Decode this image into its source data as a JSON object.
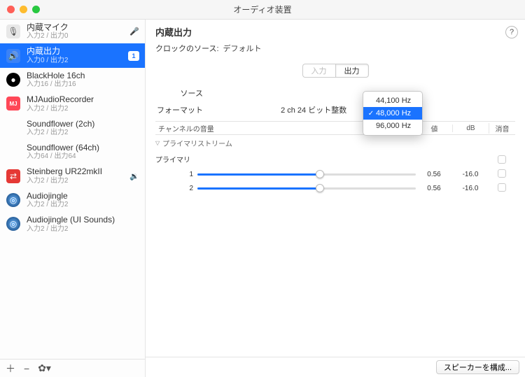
{
  "window": {
    "title": "オーディオ装置"
  },
  "sidebar": {
    "devices": [
      {
        "name": "内蔵マイク",
        "sub": "入力2 / 出力0",
        "icon": "mic",
        "indicator": "mic"
      },
      {
        "name": "内蔵出力",
        "sub": "入力0 / 出力2",
        "icon": "speaker",
        "selected": true,
        "badge": "1"
      },
      {
        "name": "BlackHole 16ch",
        "sub": "入力16 / 出力16",
        "icon": "blackhole"
      },
      {
        "name": "MJAudioRecorder",
        "sub": "入力2 / 出力2",
        "icon": "mj"
      },
      {
        "name": "Soundflower (2ch)",
        "sub": "入力2 / 出力2",
        "icon": "generic"
      },
      {
        "name": "Soundflower (64ch)",
        "sub": "入力64 / 出力64",
        "icon": "generic"
      },
      {
        "name": "Steinberg UR22mkII",
        "sub": "入力2 / 出力2",
        "icon": "steinberg",
        "indicator": "vol"
      },
      {
        "name": "Audiojingle",
        "sub": "入力2 / 出力2",
        "icon": "audiojingle"
      },
      {
        "name": "Audiojingle (UI Sounds)",
        "sub": "入力2 / 出力2",
        "icon": "audiojingle"
      }
    ],
    "footer": {
      "add": "＋",
      "remove": "−",
      "gear": "✿▾"
    }
  },
  "main": {
    "title": "内蔵出力",
    "help": "?",
    "clock_label": "クロックのソース:",
    "clock_value": "デフォルト",
    "tabs": {
      "input": "入力",
      "output": "出力"
    },
    "source_label": "ソース",
    "format_label": "フォーマット",
    "format_suffix": "2 ch 24 ビット整数",
    "sample_rates": [
      "44,100 Hz",
      "48,000 Hz",
      "96,000 Hz"
    ],
    "selected_rate": "48,000 Hz",
    "table_head": {
      "name": "チャンネルの音量",
      "value": "値",
      "db": "dB",
      "mute": "消音"
    },
    "stream_header": "プライマリストリーム",
    "primary_label": "プライマリ",
    "channels": [
      {
        "id": "1",
        "value": "0.56",
        "db": "-16.0",
        "fill": 56
      },
      {
        "id": "2",
        "value": "0.56",
        "db": "-16.0",
        "fill": 56
      }
    ],
    "configure": "スピーカーを構成..."
  }
}
